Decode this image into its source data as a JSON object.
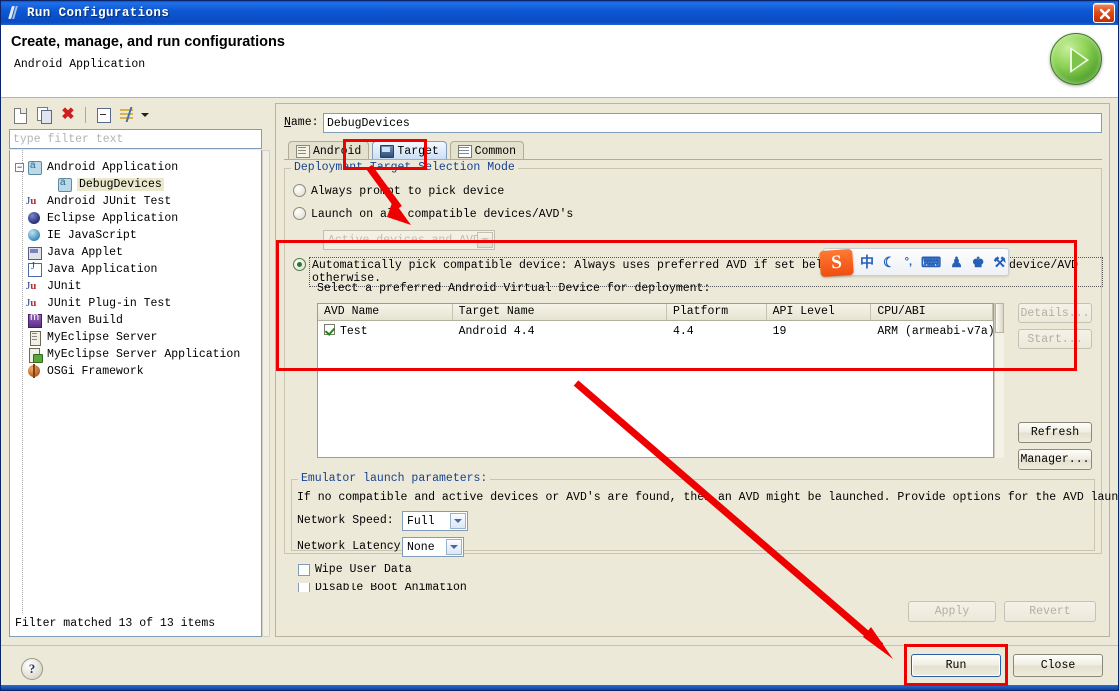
{
  "window": {
    "title": "Run Configurations",
    "close_label": "x",
    "icon": "wrench-icon"
  },
  "header": {
    "title": "Create, manage, and run configurations",
    "subtitle": "Android Application",
    "run_icon": "green-play-icon"
  },
  "sidebar": {
    "toolbar": [
      {
        "name": "new-configuration-icon",
        "label": ""
      },
      {
        "name": "duplicate-configuration-icon",
        "label": ""
      },
      {
        "name": "delete-configuration-icon",
        "label": "✖"
      },
      {
        "name": "collapse-all-icon",
        "label": ""
      },
      {
        "name": "filter-icon",
        "label": ""
      }
    ],
    "filter_placeholder": "type filter text",
    "filter_value": "",
    "tree": [
      {
        "label": "Android Application",
        "icon": "android-icon",
        "level": 0,
        "expanded": true,
        "selected": false
      },
      {
        "label": "DebugDevices",
        "icon": "android-icon",
        "level": 1,
        "expanded": false,
        "selected": true
      },
      {
        "label": "Android JUnit Test",
        "icon": "junit-android-icon",
        "level": 0,
        "expanded": false,
        "selected": false
      },
      {
        "label": "Eclipse Application",
        "icon": "eclipse-icon",
        "level": 0,
        "expanded": false,
        "selected": false
      },
      {
        "label": "IE JavaScript",
        "icon": "ie-icon",
        "level": 0,
        "expanded": false,
        "selected": false
      },
      {
        "label": "Java Applet",
        "icon": "java-applet-icon",
        "level": 0,
        "expanded": false,
        "selected": false
      },
      {
        "label": "Java Application",
        "icon": "java-application-icon",
        "level": 0,
        "expanded": false,
        "selected": false
      },
      {
        "label": "JUnit",
        "icon": "junit-icon",
        "level": 0,
        "expanded": false,
        "selected": false
      },
      {
        "label": "JUnit Plug-in Test",
        "icon": "junit-plugin-icon",
        "level": 0,
        "expanded": false,
        "selected": false
      },
      {
        "label": "Maven Build",
        "icon": "maven-icon",
        "level": 0,
        "expanded": false,
        "selected": false
      },
      {
        "label": "MyEclipse Server",
        "icon": "server-icon",
        "level": 0,
        "expanded": false,
        "selected": false
      },
      {
        "label": "MyEclipse Server Application",
        "icon": "server-application-icon",
        "level": 0,
        "expanded": false,
        "selected": false
      },
      {
        "label": "OSGi Framework",
        "icon": "osgi-icon",
        "level": 0,
        "expanded": false,
        "selected": false
      }
    ],
    "filter_status": "Filter matched 13 of 13 items"
  },
  "main": {
    "name_label": "Name:",
    "name_value": "DebugDevices",
    "tabs": [
      {
        "label": "Android",
        "icon": "android-tab-icon",
        "active": false
      },
      {
        "label": "Target",
        "icon": "target-tab-icon",
        "active": true
      },
      {
        "label": "Common",
        "icon": "common-tab-icon",
        "active": false
      }
    ],
    "deployment": {
      "group_title": "Deployment Target Selection Mode",
      "options": [
        {
          "label": "Always prompt to pick device",
          "selected": false
        },
        {
          "label": "Launch on all compatible devices/AVD's",
          "selected": false
        },
        {
          "label": "Automatically pick compatible device: Always uses preferred AVD if set below, launches on compatible device/AVD otherwise.",
          "selected": true
        }
      ],
      "combo_value": "Active devices and AVD's",
      "combo_disabled": true,
      "avd_prompt": "Select a preferred Android Virtual Device for deployment:"
    },
    "avd_table": {
      "columns": [
        "AVD Name",
        "Target Name",
        "Platform",
        "API Level",
        "CPU/ABI"
      ],
      "rows": [
        {
          "checked": true,
          "avd_name": "Test",
          "target_name": "Android 4.4",
          "platform": "4.4",
          "api_level": "19",
          "cpu_abi": "ARM (armeabi-v7a)"
        }
      ]
    },
    "side_buttons": [
      {
        "label": "Details...",
        "disabled": true,
        "name": "details-button"
      },
      {
        "label": "Start...",
        "disabled": true,
        "name": "start-button"
      },
      {
        "label": "Refresh",
        "disabled": false,
        "name": "refresh-button"
      },
      {
        "label": "Manager...",
        "disabled": false,
        "name": "manager-button"
      }
    ],
    "emulator": {
      "group_title": "Emulator launch parameters:",
      "hint": "If no compatible and active devices or AVD's are found, then an AVD might be launched. Provide options for the AVD launch below.",
      "network_speed_label": "Network Speed:",
      "network_speed_value": "Full",
      "network_latency_label": "Network Latency:",
      "network_latency_value": "None",
      "checkboxes": [
        {
          "label": "Wipe User Data",
          "checked": false
        },
        {
          "label": "Disable Boot Animation",
          "checked": false
        }
      ]
    }
  },
  "footer": {
    "apply_label": "Apply",
    "apply_disabled": true,
    "revert_label": "Revert",
    "revert_disabled": true,
    "run_label": "Run",
    "close_label": "Close",
    "help_label": "?"
  },
  "ime": {
    "logo": "S",
    "items": [
      {
        "name": "chinese-mode-icon",
        "glyph": "中"
      },
      {
        "name": "moon-icon",
        "glyph": "☾"
      },
      {
        "name": "punctuation-icon",
        "glyph": "°,"
      },
      {
        "name": "keyboard-icon",
        "glyph": "⌨"
      },
      {
        "name": "user-icon",
        "glyph": "♟"
      },
      {
        "name": "skin-icon",
        "glyph": "♚"
      },
      {
        "name": "toolbox-icon",
        "glyph": "⚒"
      }
    ]
  },
  "annotations": {
    "color": "#ee0000",
    "boxes": [
      "target-tab-highlight",
      "deployment-section-highlight",
      "run-button-highlight"
    ],
    "arrows": [
      "arrow-to-radio-options",
      "arrow-to-run-button"
    ]
  }
}
